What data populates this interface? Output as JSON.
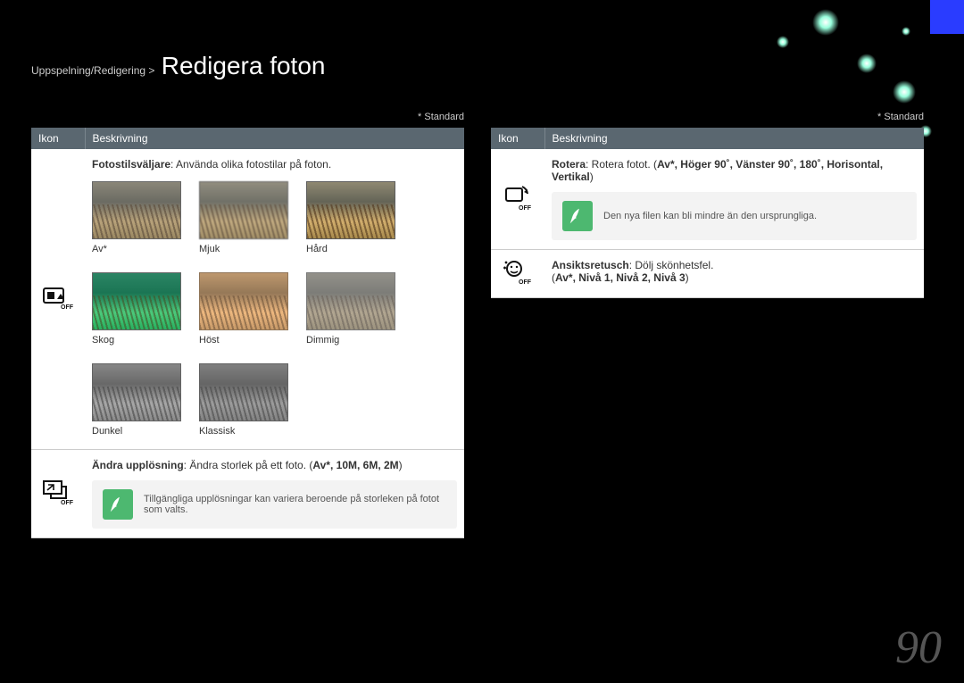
{
  "breadcrumb": {
    "path": "Uppspelning/Redigering >",
    "title": "Redigera foton"
  },
  "standard_marker": "* Standard",
  "headers": {
    "ikon": "Ikon",
    "besk": "Beskrivning"
  },
  "left": {
    "row1": {
      "label": "Fotostilsväljare",
      "text": ": Använda olika fotostilar på foton.",
      "thumbs": [
        {
          "caption": "Av*",
          "cls": "av"
        },
        {
          "caption": "Mjuk",
          "cls": "mjuk"
        },
        {
          "caption": "Hård",
          "cls": "hard"
        },
        {
          "caption": "Skog",
          "cls": "skog"
        },
        {
          "caption": "Höst",
          "cls": "host"
        },
        {
          "caption": "Dimmig",
          "cls": "dimmig"
        },
        {
          "caption": "Dunkel",
          "cls": "dunkel"
        },
        {
          "caption": "Klassisk",
          "cls": "klassisk"
        }
      ]
    },
    "row2": {
      "label": "Ändra upplösning",
      "text": ": Ändra storlek på ett foto. (",
      "opts": "Av*, 10M, 6M, 2M",
      "close": ")",
      "note": "Tillgängliga upplösningar kan variera beroende på storleken på fotot som valts."
    }
  },
  "right": {
    "row1": {
      "label": "Rotera",
      "text": ": Rotera fotot. (",
      "opts": "Av*, Höger 90˚, Vänster 90˚, 180˚, Horisontal, Vertikal",
      "close": ")",
      "note": "Den nya filen kan bli mindre än den ursprungliga."
    },
    "row2": {
      "label": "Ansiktsretusch",
      "text": ": Dölj skönhetsfel.",
      "optsline_open": "(",
      "opts": "Av*, Nivå 1, Nivå 2, Nivå 3",
      "optsline_close": ")"
    }
  },
  "page": "90"
}
